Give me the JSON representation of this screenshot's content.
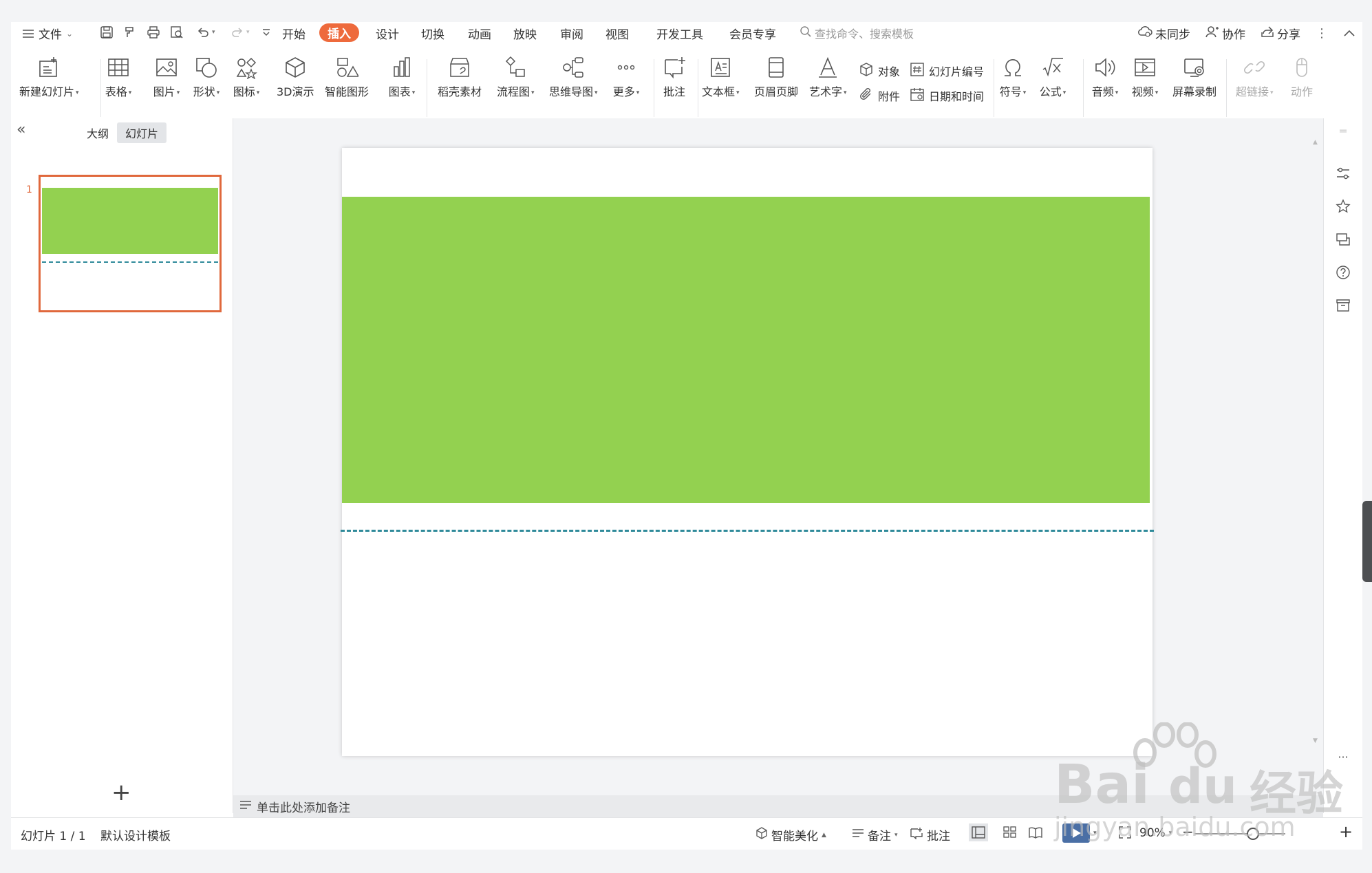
{
  "menu": {
    "hamburger_icon": "menu-icon",
    "file_label": "文件",
    "tabs": [
      "开始",
      "插入",
      "设计",
      "切换",
      "动画",
      "放映",
      "审阅",
      "视图",
      "开发工具",
      "会员专享"
    ],
    "active_tab": "插入",
    "search_placeholder": "查找命令、搜索模板",
    "right": {
      "sync": "未同步",
      "collab": "协作",
      "share": "分享"
    }
  },
  "ribbon": {
    "new_slide": "新建幻灯片",
    "table": "表格",
    "picture": "图片",
    "shape": "形状",
    "icon": "图标",
    "demo3d": "3D演示",
    "smartart": "智能图形",
    "chart": "图表",
    "daoke": "稻壳素材",
    "flowchart": "流程图",
    "mindmap": "思维导图",
    "more": "更多",
    "comment": "批注",
    "textbox": "文本框",
    "header_footer": "页眉页脚",
    "wordart": "艺术字",
    "object": "对象",
    "slide_number": "幻灯片编号",
    "attachment": "附件",
    "datetime": "日期和时间",
    "symbol": "符号",
    "formula": "公式",
    "audio": "音频",
    "video": "视频",
    "screen_record": "屏幕录制",
    "hyperlink": "超链接",
    "action": "动作"
  },
  "left_pane": {
    "tab_outline": "大纲",
    "tab_slides": "幻灯片",
    "active_tab": "幻灯片",
    "slide_number": "1"
  },
  "notes_placeholder": "单击此处添加备注",
  "status": {
    "slide_info": "幻灯片 1 / 1",
    "template": "默认设计模板",
    "beautify": "智能美化",
    "notes": "备注",
    "comment": "批注",
    "zoom": "90%"
  },
  "watermark": {
    "brand": "Bai",
    "brand2": "du",
    "cn": "经验",
    "url": "jingyan.baidu.com"
  },
  "colors": {
    "accent": "#ee6a3c",
    "slide_green": "#93d150",
    "dash_teal": "#2f8a9a"
  }
}
